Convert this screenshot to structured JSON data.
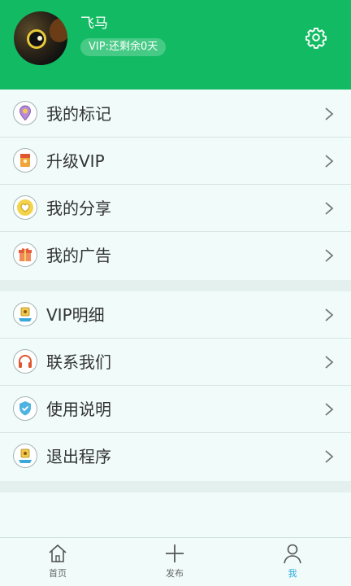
{
  "profile": {
    "name": "飞马",
    "vip_status": "VIP:还剩余0天"
  },
  "menu_group1": [
    {
      "label": "我的标记",
      "icon": "location-pin-icon"
    },
    {
      "label": "升级VIP",
      "icon": "upgrade-gift-icon"
    },
    {
      "label": "我的分享",
      "icon": "heart-share-icon"
    },
    {
      "label": "我的广告",
      "icon": "gift-box-icon"
    }
  ],
  "menu_group2": [
    {
      "label": "VIP明细",
      "icon": "vip-detail-icon"
    },
    {
      "label": "联系我们",
      "icon": "headphones-icon"
    },
    {
      "label": "使用说明",
      "icon": "shield-check-icon"
    },
    {
      "label": "退出程序",
      "icon": "exit-icon"
    }
  ],
  "tabs": [
    {
      "label": "首页",
      "icon": "home-icon"
    },
    {
      "label": "发布",
      "icon": "plus-icon"
    },
    {
      "label": "我",
      "icon": "user-icon",
      "active": true
    }
  ],
  "colors": {
    "header_bg": "#12bb63",
    "active_tab": "#2eaadc",
    "page_bg": "#f0fbfa"
  }
}
